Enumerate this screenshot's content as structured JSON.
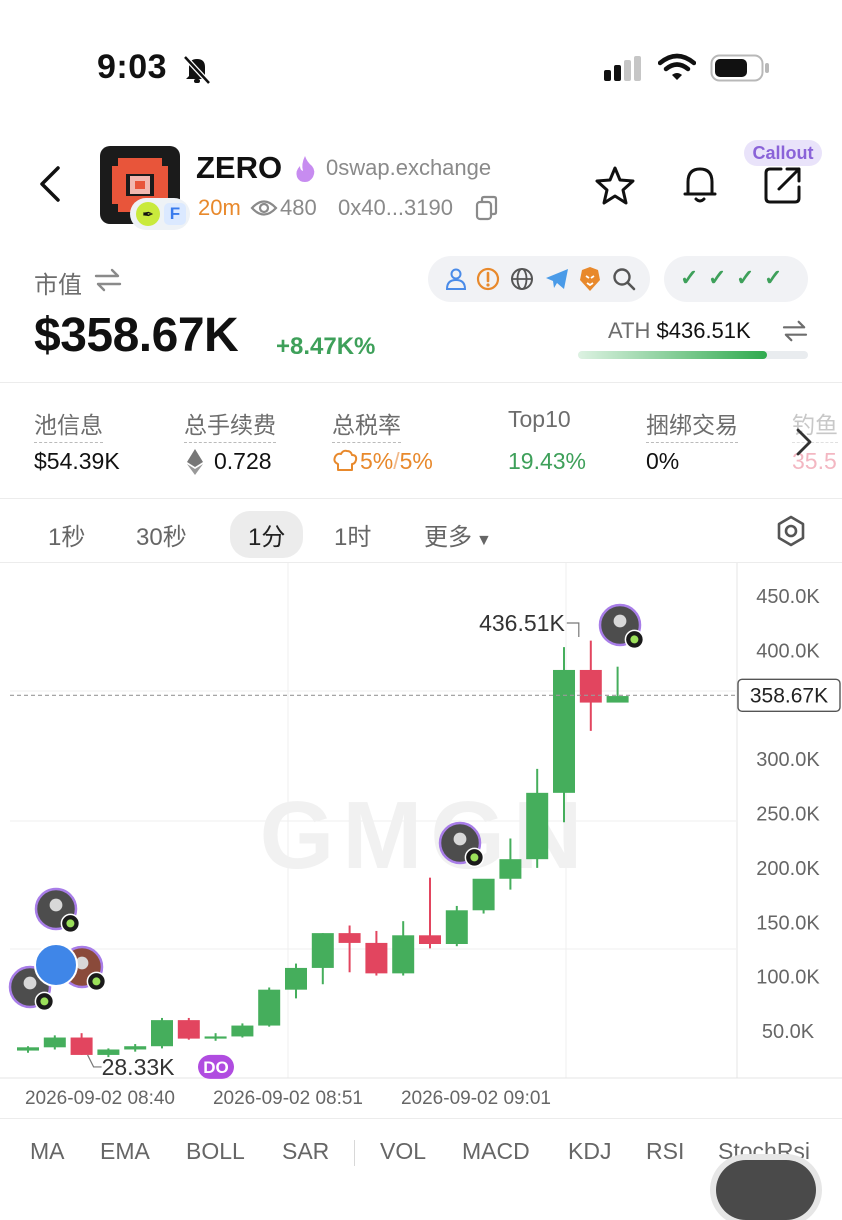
{
  "status_bar": {
    "time": "9:03"
  },
  "header": {
    "title": "ZERO",
    "site": "0swap.exchange",
    "age": "20m",
    "views": "480",
    "address": "0x40...3190",
    "callout_label": "Callout"
  },
  "market": {
    "label": "市值",
    "value": "$358.67K",
    "change": "+8.47K%",
    "ath_label": "ATH",
    "ath_value": "$436.51K",
    "ath_progress": 0.82
  },
  "stats": [
    {
      "label": "池信息",
      "value": "$54.39K"
    },
    {
      "label": "总手续费",
      "value": "0.728"
    },
    {
      "label": "总税率",
      "value_a": "5%",
      "sep": "/",
      "value_b": "5%"
    },
    {
      "label": "Top10",
      "value": "19.43%"
    },
    {
      "label": "捆绑交易",
      "value": "0%"
    },
    {
      "label": "钓鱼",
      "value": "35.5"
    }
  ],
  "timeframes": [
    "1秒",
    "30秒",
    "1分",
    "1时",
    "更多"
  ],
  "selected_timeframe": "1分",
  "chart_data": {
    "type": "candlestick",
    "y_ticks": [
      "450.0K",
      "400.0K",
      "350.0K",
      "300.0K",
      "250.0K",
      "200.0K",
      "150.0K",
      "100.0K",
      "50.0K"
    ],
    "x_ticks": [
      "2026-09-02 08:40",
      "2026-09-02 08:51",
      "2026-09-02 09:01"
    ],
    "current_price_label": "358.67K",
    "high_label": "436.51K",
    "low_label": "28.33K",
    "low_badge": "DO",
    "watermark": "GMGN",
    "current_value": 358.67,
    "candles": [
      {
        "o": 32,
        "h": 36,
        "l": 30,
        "c": 35
      },
      {
        "o": 35,
        "h": 46,
        "l": 33,
        "c": 44
      },
      {
        "o": 44,
        "h": 48,
        "l": 28,
        "c": 28
      },
      {
        "o": 28,
        "h": 34,
        "l": 26,
        "c": 33
      },
      {
        "o": 33,
        "h": 38,
        "l": 31,
        "c": 36
      },
      {
        "o": 36,
        "h": 62,
        "l": 34,
        "c": 60
      },
      {
        "o": 60,
        "h": 62,
        "l": 42,
        "c": 43
      },
      {
        "o": 43,
        "h": 48,
        "l": 41,
        "c": 45
      },
      {
        "o": 45,
        "h": 57,
        "l": 44,
        "c": 55
      },
      {
        "o": 55,
        "h": 90,
        "l": 54,
        "c": 88
      },
      {
        "o": 88,
        "h": 112,
        "l": 80,
        "c": 108
      },
      {
        "o": 108,
        "h": 140,
        "l": 93,
        "c": 140
      },
      {
        "o": 140,
        "h": 147,
        "l": 104,
        "c": 131
      },
      {
        "o": 131,
        "h": 142,
        "l": 101,
        "c": 103
      },
      {
        "o": 103,
        "h": 151,
        "l": 101,
        "c": 138
      },
      {
        "o": 138,
        "h": 191,
        "l": 126,
        "c": 130
      },
      {
        "o": 130,
        "h": 165,
        "l": 128,
        "c": 161
      },
      {
        "o": 161,
        "h": 186,
        "l": 158,
        "c": 190
      },
      {
        "o": 190,
        "h": 227,
        "l": 180,
        "c": 208
      },
      {
        "o": 208,
        "h": 291,
        "l": 200,
        "c": 269
      },
      {
        "o": 269,
        "h": 403,
        "l": 242,
        "c": 382
      },
      {
        "o": 382,
        "h": 409,
        "l": 326,
        "c": 352
      },
      {
        "o": 352,
        "h": 385,
        "l": 356,
        "c": 358
      }
    ]
  },
  "indicators": [
    "MA",
    "EMA",
    "BOLL",
    "SAR",
    "VOL",
    "MACD",
    "KDJ",
    "RSI",
    "StochRsi"
  ],
  "colors": {
    "up": "#45ae5c",
    "down": "#e2455f",
    "accent": "#8a63d8"
  }
}
